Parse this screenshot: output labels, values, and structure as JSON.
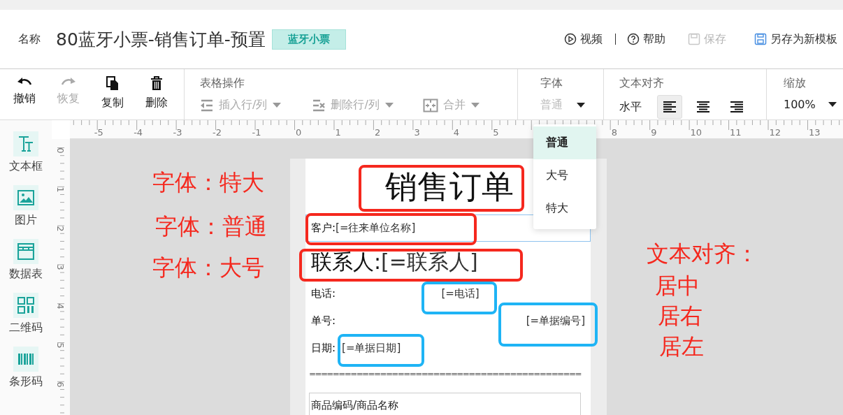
{
  "header": {
    "name_label": "名称",
    "title": "80蓝牙小票-销售订单-预置",
    "tag": "蓝牙小票",
    "actions": [
      {
        "kind": "video",
        "label": "视频",
        "disabled": false
      },
      {
        "kind": "help",
        "label": "帮助",
        "disabled": false
      },
      {
        "kind": "save",
        "label": "保存",
        "disabled": true
      },
      {
        "kind": "save_as",
        "label": "另存为新模板",
        "disabled": false
      }
    ]
  },
  "toolbar": {
    "edit_buttons": [
      {
        "kind": "undo",
        "label": "撤销",
        "disabled": false
      },
      {
        "kind": "redo",
        "label": "恢复",
        "disabled": true
      },
      {
        "kind": "copy",
        "label": "复制",
        "disabled": false
      },
      {
        "kind": "delete",
        "label": "删除",
        "disabled": false
      }
    ],
    "table_ops": {
      "title": "表格操作",
      "buttons": [
        {
          "kind": "insert",
          "label": "插入行/列",
          "disabled": true
        },
        {
          "kind": "remove",
          "label": "删除行/列",
          "disabled": true
        },
        {
          "kind": "merge",
          "label": "合并",
          "disabled": true
        }
      ]
    },
    "font": {
      "title": "字体",
      "value": "普通",
      "expanded": true,
      "options": [
        {
          "label": "普通",
          "selected": true
        },
        {
          "label": "大号",
          "selected": false
        },
        {
          "label": "特大",
          "selected": false
        }
      ]
    },
    "align": {
      "title": "文本对齐",
      "label": "水平",
      "buttons": [
        {
          "kind": "left",
          "selected": true
        },
        {
          "kind": "center",
          "selected": false
        },
        {
          "kind": "right",
          "selected": false
        }
      ]
    },
    "zoom": {
      "title": "缩放",
      "value": "100%"
    }
  },
  "ruler": {
    "x_ticks": [
      "-5",
      "-4",
      "-3",
      "-2",
      "-1",
      "0",
      "1",
      "2",
      "3",
      "4",
      "5",
      "8",
      "9",
      "10",
      "11",
      "12",
      "13"
    ],
    "y_ticks": [
      "0",
      "1",
      "2",
      "3",
      "4",
      "5",
      "6"
    ]
  },
  "sidebar": {
    "items": [
      {
        "kind": "textbox",
        "label": "文本框"
      },
      {
        "kind": "image",
        "label": "图片"
      },
      {
        "kind": "table",
        "label": "数据表"
      },
      {
        "kind": "qrcode",
        "label": "二维码"
      },
      {
        "kind": "barcode",
        "label": "条形码"
      }
    ]
  },
  "receipt": {
    "title": "销售订单",
    "fields": [
      {
        "kind": "normal",
        "label": "客户:",
        "value": "[=往来单位名称]",
        "selected": true
      },
      {
        "kind": "large",
        "label": "联系人:",
        "value": "[=联系人]",
        "selected": false
      },
      {
        "kind": "center",
        "label": "电话:",
        "value": "[=电话]"
      },
      {
        "kind": "right",
        "label": "单号:",
        "value": "[=单据编号]"
      },
      {
        "kind": "left",
        "label": "日期:",
        "value": "[=单据日期]"
      }
    ],
    "separator": "==============================================",
    "table_header": "商品编码/商品名称"
  },
  "annotations": {
    "notes": [
      "字体：特大",
      "字体：普通",
      "字体：大号",
      "文本对齐：",
      "居中",
      "居右",
      "居左"
    ],
    "highlights": [
      {
        "color": "#f5281e"
      },
      {
        "color": "#f5281e"
      },
      {
        "color": "#f5281e"
      },
      {
        "color": "#1eb4f5"
      },
      {
        "color": "#1eb4f5"
      },
      {
        "color": "#1eb4f5"
      }
    ]
  }
}
